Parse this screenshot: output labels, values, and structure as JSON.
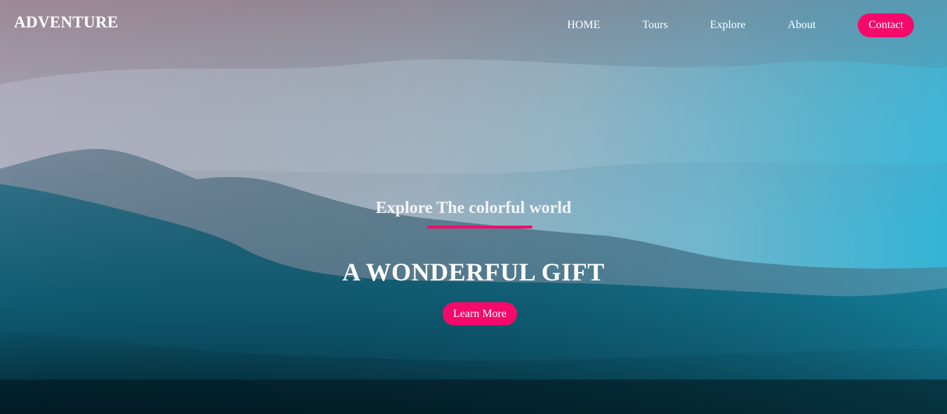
{
  "brand": {
    "name": "ADVENTURE"
  },
  "nav": {
    "items": [
      {
        "label": "HOME"
      },
      {
        "label": "Tours"
      },
      {
        "label": "Explore"
      },
      {
        "label": "About"
      },
      {
        "label": "Contact"
      }
    ]
  },
  "hero": {
    "tagline": "Explore The colorful world",
    "headline": "A WONDERFUL GIFT",
    "button_label": "Learn More",
    "background": "misty mountain landscape photo"
  },
  "colors": {
    "accent": "#f50a6b",
    "text": "#ffffff"
  }
}
